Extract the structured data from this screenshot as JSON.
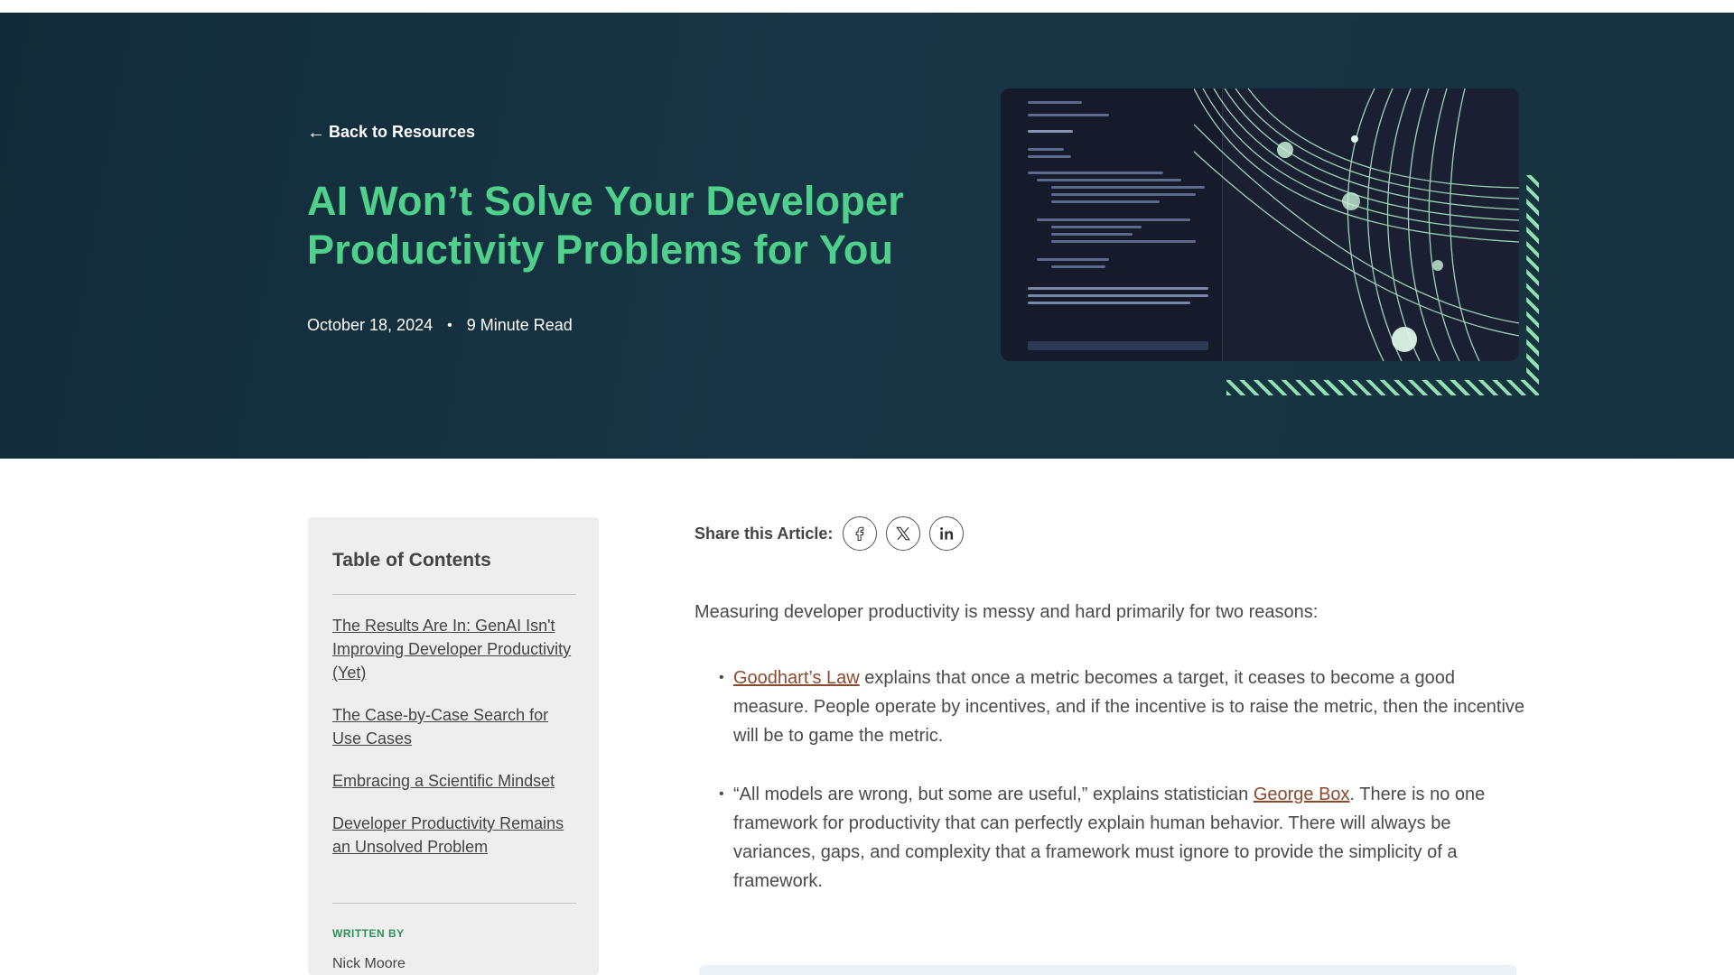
{
  "hero": {
    "back_link": "Back to Resources",
    "title": "AI Won’t Solve Your Developer Productivity Problems for You",
    "date": "October 18, 2024",
    "separator": "•",
    "read_time": "9 Minute Read",
    "colors": {
      "background": "#17323f",
      "title": "#4fd18b",
      "accent_hatch": "#8fe3b0"
    }
  },
  "toc": {
    "title": "Table of Contents",
    "items": [
      {
        "label": "The Results Are In: GenAI Isn't Improving Developer Productivity (Yet)"
      },
      {
        "label": "The Case-by-Case Search for Use Cases"
      },
      {
        "label": "Embracing a Scientific Mindset"
      },
      {
        "label": "Developer Productivity Remains an Unsolved Problem"
      }
    ],
    "written_by_label": "WRITTEN BY",
    "author": "Nick Moore"
  },
  "share": {
    "label": "Share this Article:",
    "buttons": [
      {
        "icon": "facebook-icon",
        "glyph": "f"
      },
      {
        "icon": "x-icon",
        "glyph": "𝕏"
      },
      {
        "icon": "linkedin-icon",
        "glyph": "in"
      }
    ]
  },
  "article": {
    "intro": "Measuring developer productivity is messy and hard primarily for two reasons:",
    "bullet_1": {
      "link": "Goodhart’s Law",
      "text": " explains that once a metric becomes a target, it ceases to become a good measure. People operate by incentives, and if the incentive is to raise the metric, then the incentive will be to game the metric."
    },
    "bullet_2": {
      "before": "“All models are wrong, but some are useful,” explains statistician ",
      "link": "George Box",
      "after": ". There is no one framework for productivity that can perfectly explain human behavior. There will always be variances, gaps, and complexity that a framework must ignore to provide the simplicity of a framework."
    },
    "link_color": "#8a4a2d"
  }
}
